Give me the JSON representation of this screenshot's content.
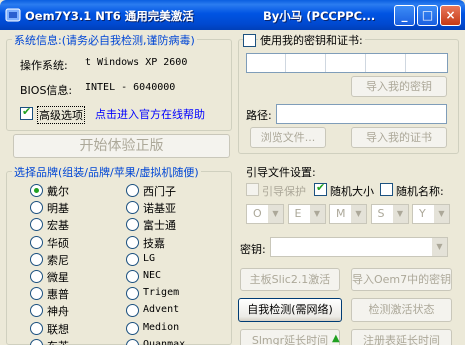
{
  "window": {
    "title": "Oem7Y3.1 NT6 通用完美激活",
    "title_right": "By小马 (PCCPPC...",
    "buttons": {
      "minimize": "_",
      "maximize": "□",
      "close": "×"
    }
  },
  "system_info": {
    "heading": "系统信息:(请务必自我检测,谨防病毒)",
    "os_label": "操作系统:",
    "os_value": "t Windows XP 2600",
    "bios_label": "BIOS信息:",
    "bios_value": "INTEL  - 6040000",
    "advanced_option": "高级选项",
    "advanced_checked": true,
    "help_link": "点击进入官方在线帮助"
  },
  "start_button": "开始体验正版",
  "brands": {
    "heading": "选择品牌(组装/品牌/苹果/虚拟机随便)",
    "left": [
      "戴尔",
      "明基",
      "宏基",
      "华硕",
      "索尼",
      "微星",
      "惠普",
      "神舟",
      "联想",
      "东芝"
    ],
    "right": [
      "西门子",
      "诺基亚",
      "富士通",
      "技嘉",
      "LG",
      "NEC",
      "Trigem",
      "Advent",
      "Medion",
      "Quanmax"
    ],
    "selected": "戴尔"
  },
  "key_cert": {
    "checkbox_label": "使用我的密钥和证书:",
    "checked": false,
    "key_boxes": [
      "",
      "",
      "",
      "",
      ""
    ],
    "import_key_button": "导入我的密钥",
    "path_label": "路径:",
    "path_value": "",
    "browse_button": "浏览文件...",
    "import_cert_button": "导入我的证书"
  },
  "boot_settings": {
    "heading": "引导文件设置:",
    "boot_protect": "引导保护",
    "boot_protect_checked": false,
    "random_size": "随机大小",
    "random_size_checked": true,
    "random_name": "随机名称:",
    "random_name_checked": false,
    "name_chars": [
      "O",
      "E",
      "M",
      "S",
      "Y"
    ]
  },
  "activation": {
    "key_label": "密钥:",
    "key_value": "",
    "slic_button": "主板Slic2.1激活",
    "import_oem_key_button": "导入Oem7中的密钥",
    "self_check_button": "自我检测(需网络)",
    "check_status_button": "检测激活状态",
    "slmgr_button": "Slmgr延长时间",
    "registry_button": "注册表延长时间"
  },
  "colors": {
    "titlebar": "#0054e3",
    "group_title": "#0046d5",
    "link": "#0000ff",
    "check": "#21a121"
  }
}
